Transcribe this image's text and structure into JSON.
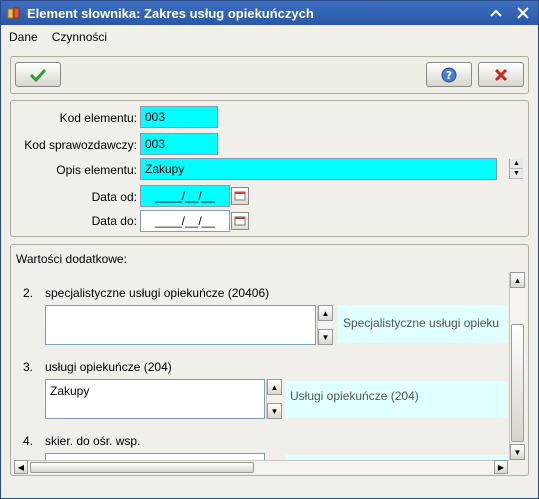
{
  "window": {
    "title": "Element słownika: Zakres usług opiekuńczych"
  },
  "menu": {
    "items": [
      "Dane",
      "Czynności"
    ]
  },
  "form": {
    "kod_elementu_label": "Kod elementu:",
    "kod_elementu_value": "003",
    "kod_sprawozdawczy_label": "Kod sprawozdawczy:",
    "kod_sprawozdawczy_value": "003",
    "opis_label": "Opis elementu:",
    "opis_value": "Zakupy",
    "data_od_label": "Data od:",
    "data_od_value": "____/__/__",
    "data_do_label": "Data do:",
    "data_do_value": "____/__/__"
  },
  "extra": {
    "title": "Wartości dodatkowe:",
    "items": [
      {
        "num": "2.",
        "label": "specjalistyczne usługi opiekuńcze (20406)",
        "value": "",
        "desc": "Specjalistyczne usługi opieku"
      },
      {
        "num": "3.",
        "label": "usługi opiekuńcze (204)",
        "value": "Zakupy",
        "desc": "Usługi opiekuńcze (204)"
      },
      {
        "num": "4.",
        "label": "skier. do ośr. wsp.",
        "value": "",
        "desc": ""
      }
    ]
  },
  "colors": {
    "accent_field": "#00ffff",
    "desc_bg": "#e0ffff",
    "titlebar": "#2a58a8"
  }
}
